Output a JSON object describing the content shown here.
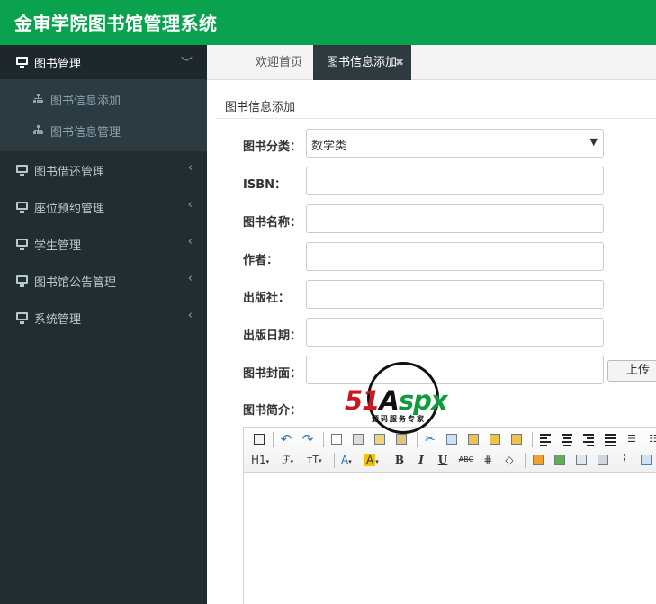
{
  "app": {
    "title": "金审学院图书馆管理系统"
  },
  "sidebar": {
    "groups": [
      {
        "label": "图书管理",
        "open": true,
        "chevron": "﹀",
        "items": [
          {
            "label": "图书信息添加"
          },
          {
            "label": "图书信息管理"
          }
        ]
      },
      {
        "label": "图书借还管理",
        "chevron": "‹"
      },
      {
        "label": "座位预约管理",
        "chevron": "‹"
      },
      {
        "label": "学生管理",
        "chevron": "‹"
      },
      {
        "label": "图书馆公告管理",
        "chevron": "‹"
      },
      {
        "label": "系统管理",
        "chevron": "‹"
      }
    ]
  },
  "tabs": [
    {
      "label": "欢迎首页"
    },
    {
      "label": "图书信息添加",
      "close": "✖"
    }
  ],
  "panel": {
    "heading": "图书信息添加"
  },
  "form": {
    "category": {
      "label": "图书分类：",
      "value": "数学类",
      "arrow": "▼"
    },
    "isbn": {
      "label": "ISBN：",
      "value": ""
    },
    "name": {
      "label": "图书名称：",
      "value": ""
    },
    "author": {
      "label": "作者：",
      "value": ""
    },
    "publisher": {
      "label": "出版社：",
      "value": ""
    },
    "pubdate": {
      "label": "出版日期：",
      "value": ""
    },
    "cover": {
      "label": "图书封面：",
      "value": "",
      "upload_label": "上传"
    },
    "intro": {
      "label": "图书简介："
    }
  },
  "editor": {
    "row2": {
      "heading": "H1",
      "font_family": "ℱ",
      "font_size": "тT",
      "font_color": "A",
      "bg_color": "A",
      "bold": "B",
      "italic": "I",
      "underline": "U",
      "strike": "ABC"
    }
  },
  "watermark": {
    "brand_a": "51",
    "brand_b": "A",
    "brand_c": "spx",
    "tagline": "源码服务专家"
  },
  "colors": {
    "topbar": "#0aa24f",
    "sidebar": "#222d32",
    "active_tab": "#2d3a40"
  }
}
